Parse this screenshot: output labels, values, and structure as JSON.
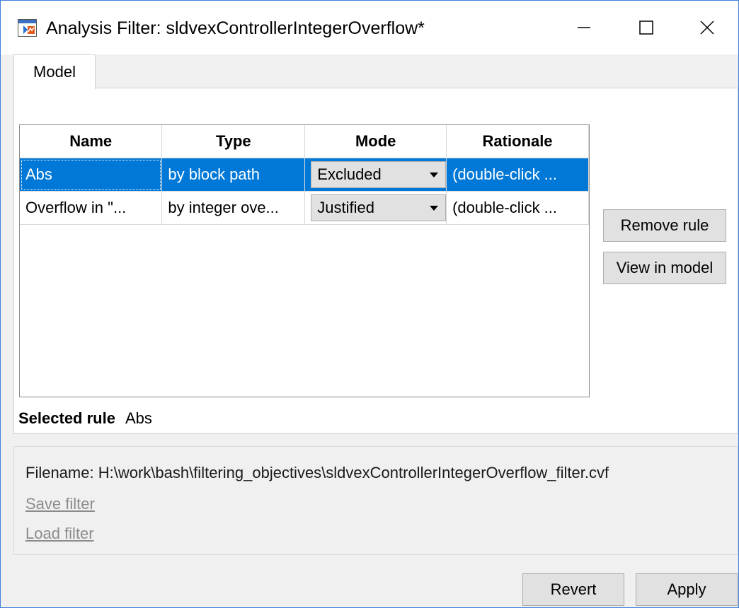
{
  "window": {
    "title": "Analysis Filter: sldvexControllerIntegerOverflow*",
    "app_icon": "matlab-window-icon",
    "controls": {
      "minimize": "minimize-icon",
      "maximize": "maximize-icon",
      "close": "close-icon"
    }
  },
  "tabs": [
    {
      "label": "Model"
    }
  ],
  "table": {
    "columns": [
      "Name",
      "Type",
      "Mode",
      "Rationale"
    ],
    "rows": [
      {
        "name": "Abs",
        "type": "by block path",
        "mode": "Excluded",
        "rationale": "(double-click ..."
      },
      {
        "name": "Overflow in \"...",
        "type": "by integer ove...",
        "mode": "Justified",
        "rationale": "(double-click ..."
      }
    ],
    "selected_index": 0
  },
  "actions": {
    "remove_rule": "Remove rule",
    "view_in_model": "View in model"
  },
  "selected_rule": {
    "label": "Selected rule",
    "value": "Abs"
  },
  "file": {
    "filename_label": "Filename: H:\\work\\bash\\filtering_objectives\\sldvexControllerIntegerOverflow_filter.cvf",
    "save_filter": "Save filter",
    "load_filter": "Load filter"
  },
  "footer": {
    "revert": "Revert",
    "apply": "Apply"
  },
  "colors": {
    "selection": "#0078d7",
    "button_face": "#e1e1e1",
    "dialog_bg": "#f0f0f0",
    "disabled_link": "#8c8c8c"
  }
}
